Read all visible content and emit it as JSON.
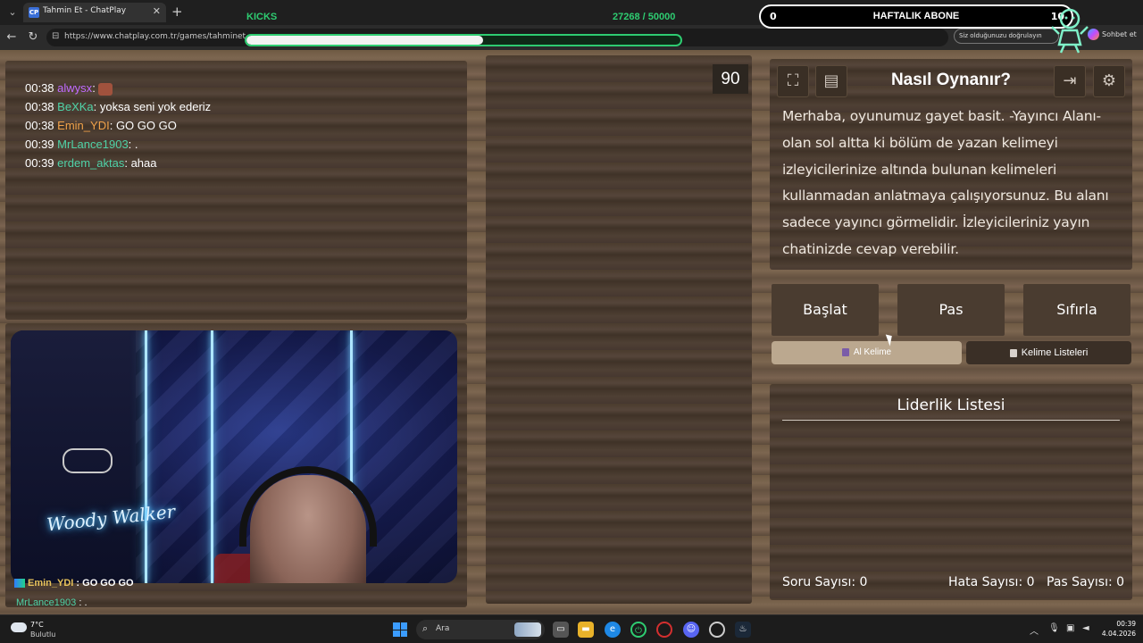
{
  "browser": {
    "tab_title": "Tahmin Et - ChatPlay",
    "tab_favicon_text": "CP",
    "url": "https://www.chatplay.com.tr/games/tahminet",
    "verify_label": "Siz olduğunuzu doğrulayın",
    "copilot_label": "Sohbet et"
  },
  "stream_overlay": {
    "kicks_label": "KICKS",
    "kicks_count": "27268 / 50000",
    "kicks_progress": 0.545,
    "sub_current": "0",
    "sub_label": "HAFTALIK ABONE",
    "sub_goal": "10",
    "accent_green": "#2ecc71"
  },
  "chat": {
    "messages": [
      {
        "time": "00:38",
        "user": "alwysx",
        "color": "#c06bff",
        "sep": ":",
        "text": "",
        "emote": true
      },
      {
        "time": "00:38",
        "user": "BeXKa",
        "color": "#4fd2a7",
        "sep": ":",
        "text": " yoksa seni yok ederiz"
      },
      {
        "time": "00:38",
        "user": "Emin_YDI",
        "color": "#f0a24a",
        "sep": ":",
        "text": " GO GO GO"
      },
      {
        "time": "00:39",
        "user": "MrLance1903",
        "color": "#4fd2a7",
        "sep": ":",
        "text": " ."
      },
      {
        "time": "00:39",
        "user": "erdem_aktas",
        "color": "#4fd2a7",
        "sep": ":",
        "text": " ahaa"
      }
    ]
  },
  "webcam": {
    "sign_text": "Woody Walker"
  },
  "stream_chat_overlay": {
    "line1_user": "Emin_YDI",
    "line1_text": " : GO GO GO",
    "line2_user": "MrLance1903",
    "line2_text": " : ."
  },
  "game": {
    "timer": "90",
    "how_title": "Nasıl Oynanır?",
    "how_text": "Merhaba, oyunumuz gayet basit. -Yayıncı Alanı- olan sol altta ki bölüm de yazan kelimeyi izleyicilerinize altında bulunan kelimeleri kullanmadan anlatmaya çalışıyorsunuz. Bu alanı sadece yayıncı görmelidir. İzleyicileriniz yayın chatinizde cevap verebilir.",
    "buttons": {
      "start": "Başlat",
      "pass": "Pas",
      "reset": "Sıfırla"
    },
    "get_word": "Al Kelime",
    "word_lists": "Kelime Listeleri",
    "leaderboard_title": "Liderlik Listesi",
    "stats": {
      "questions": "Soru Sayısı: 0",
      "errors": "Hata Sayısı: 0",
      "passes": "Pas Sayısı: 0"
    }
  },
  "taskbar": {
    "temperature": "7°C",
    "weather": "Bulutlu",
    "search_placeholder": "Ara",
    "time": "00:39",
    "date": "4.04.2026"
  }
}
